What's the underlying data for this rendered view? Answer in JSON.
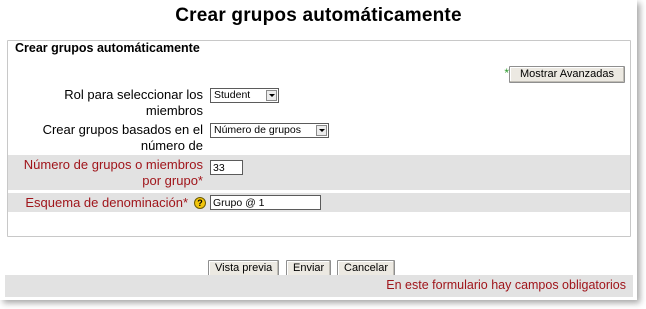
{
  "page": {
    "title": "Crear grupos automáticamente"
  },
  "form": {
    "legend": "Crear grupos automáticamente",
    "advanced": {
      "marker": "*",
      "label": "Mostrar Avanzadas"
    },
    "fields": {
      "role": {
        "label_line1": "Rol para seleccionar los",
        "label_line2": "miembros",
        "value": "Student"
      },
      "based_on": {
        "label_line1": "Crear grupos basados en el",
        "label_line2": "número de",
        "value": "Número de grupos"
      },
      "number": {
        "label_line1": "Número de grupos o miembros",
        "label_line2": "por grupo*",
        "value": "33"
      },
      "naming": {
        "label": "Esquema de denominación*",
        "help_symbol": "?",
        "value": "Grupo @ 1"
      }
    }
  },
  "buttons": {
    "preview": "Vista previa",
    "submit": "Enviar",
    "cancel": "Cancelar"
  },
  "footer": {
    "required_note": "En este formulario hay campos obligatorios"
  },
  "colors": {
    "required": "#a0151b",
    "shaded_row": "#e2e2e2",
    "advanced_marker": "#2e9a2e"
  }
}
